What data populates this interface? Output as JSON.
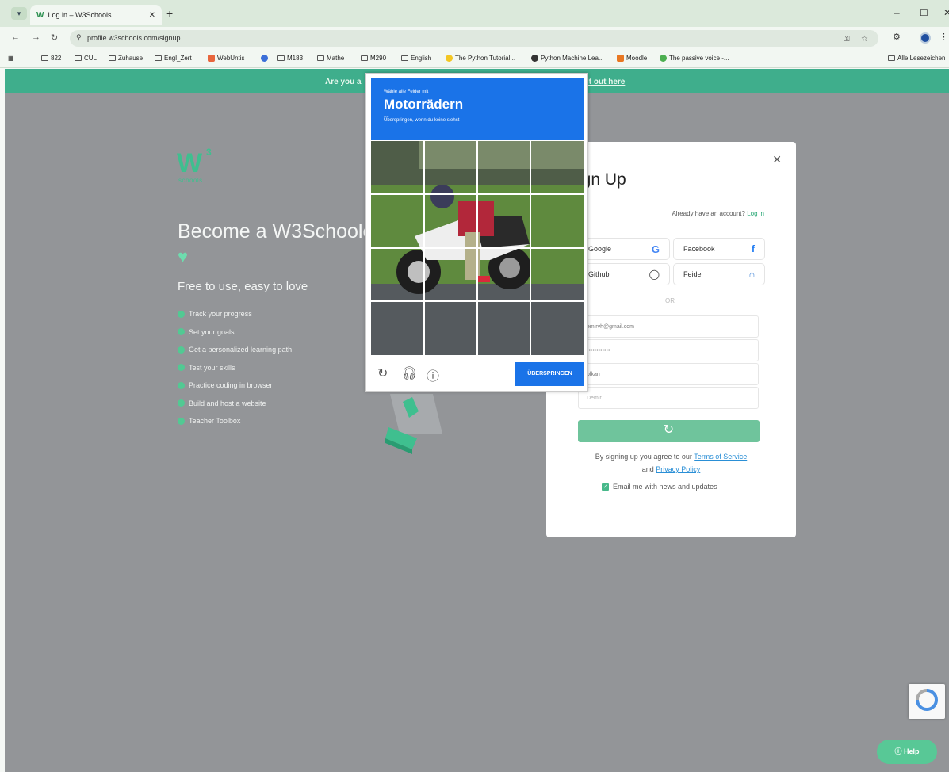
{
  "browser": {
    "tab_title": "Log in – W3Schools",
    "tab_favicon": "W",
    "url": "profile.w3schools.com/signup",
    "bookmarks": [
      "822",
      "CUL",
      "Zuhause",
      "Engl_Zert",
      "WebUntis",
      "M183",
      "Mathe",
      "M290",
      "English",
      "The Python Tutorial...",
      "Python Machine Lea...",
      "Moodle",
      "The passive voice -..."
    ],
    "all_bookmarks": "Alle Lesezeichen"
  },
  "banner": {
    "left_text": "Are you a",
    "link_text": "it out here"
  },
  "logo": {
    "main": "W",
    "sup": "3",
    "sub": "schools"
  },
  "hero": {
    "title": "Become a W3Schooler",
    "subtitle": "Free to use, easy to love",
    "features": [
      "Track your progress",
      "Set your goals",
      "Get a personalized learning path",
      "Test your skills",
      "Practice coding in browser",
      "Build and host a website",
      "Teacher Toolbox"
    ]
  },
  "signup": {
    "title": "ign Up",
    "have_account": "Already have an account?",
    "login_link": "Log in",
    "providers": [
      "Google",
      "Facebook",
      "Github",
      "Feide"
    ],
    "or": "OR",
    "email_value": "emirvh@gmail.com",
    "password_value": "••••••••••••",
    "first_name_value": "olkan",
    "last_name_placeholder": "Demir",
    "terms_prefix": "By signing up you agree to our",
    "terms_link": "Terms of Service",
    "and": "and",
    "privacy_link": "Privacy Policy",
    "email_opt": "Email me with news and updates"
  },
  "captcha": {
    "instruction": "Wähle alle Felder mit",
    "target": "Motorrädern",
    "aus": "aus",
    "skip_hint": "Überspringen, wenn du keine siehst",
    "skip_button": "ÜBERSPRINGEN"
  },
  "help": {
    "label": "Help"
  },
  "colors": {
    "brand_green": "#04AA6D",
    "captcha_blue": "#1a73e8",
    "overlay": "#939598"
  }
}
